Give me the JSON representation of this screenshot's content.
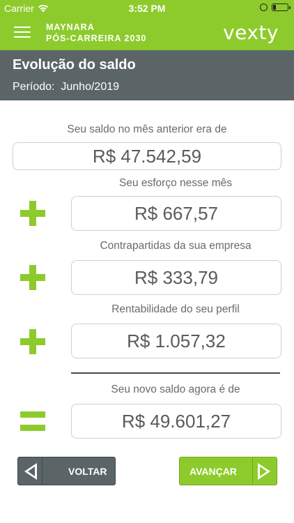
{
  "status_bar": {
    "carrier": "Carrier",
    "time": "3:52 PM",
    "wifi_icon": "wifi-icon",
    "battery_level": 0.2
  },
  "app_bar": {
    "title_line1": "MAYNARA",
    "title_line2": "PÓS-CARREIRA 2030",
    "brand": "vexty",
    "accent_color": "#8dcb2c"
  },
  "section": {
    "title": "Evolução do saldo",
    "period_label": "Período:",
    "period_value": "Junho/2019",
    "background_color": "#5b6568"
  },
  "rows": {
    "previous": {
      "label": "Seu saldo no mês anterior era de",
      "value": "R$ 47.542,59"
    },
    "effort": {
      "label": "Seu esforço nesse mês",
      "value": "R$ 667,57",
      "operator": "plus-icon"
    },
    "company": {
      "label": "Contrapartidas da sua empresa",
      "value": "R$ 333,79",
      "operator": "plus-icon"
    },
    "returns": {
      "label": "Rentabilidade do seu perfil",
      "value": "R$ 1.057,32",
      "operator": "plus-icon"
    },
    "new_balance": {
      "label": "Seu novo saldo agora é de",
      "value": "R$ 49.601,27",
      "operator": "equals-icon"
    }
  },
  "buttons": {
    "back_label": "VOLTAR",
    "next_label": "AVANÇAR"
  }
}
